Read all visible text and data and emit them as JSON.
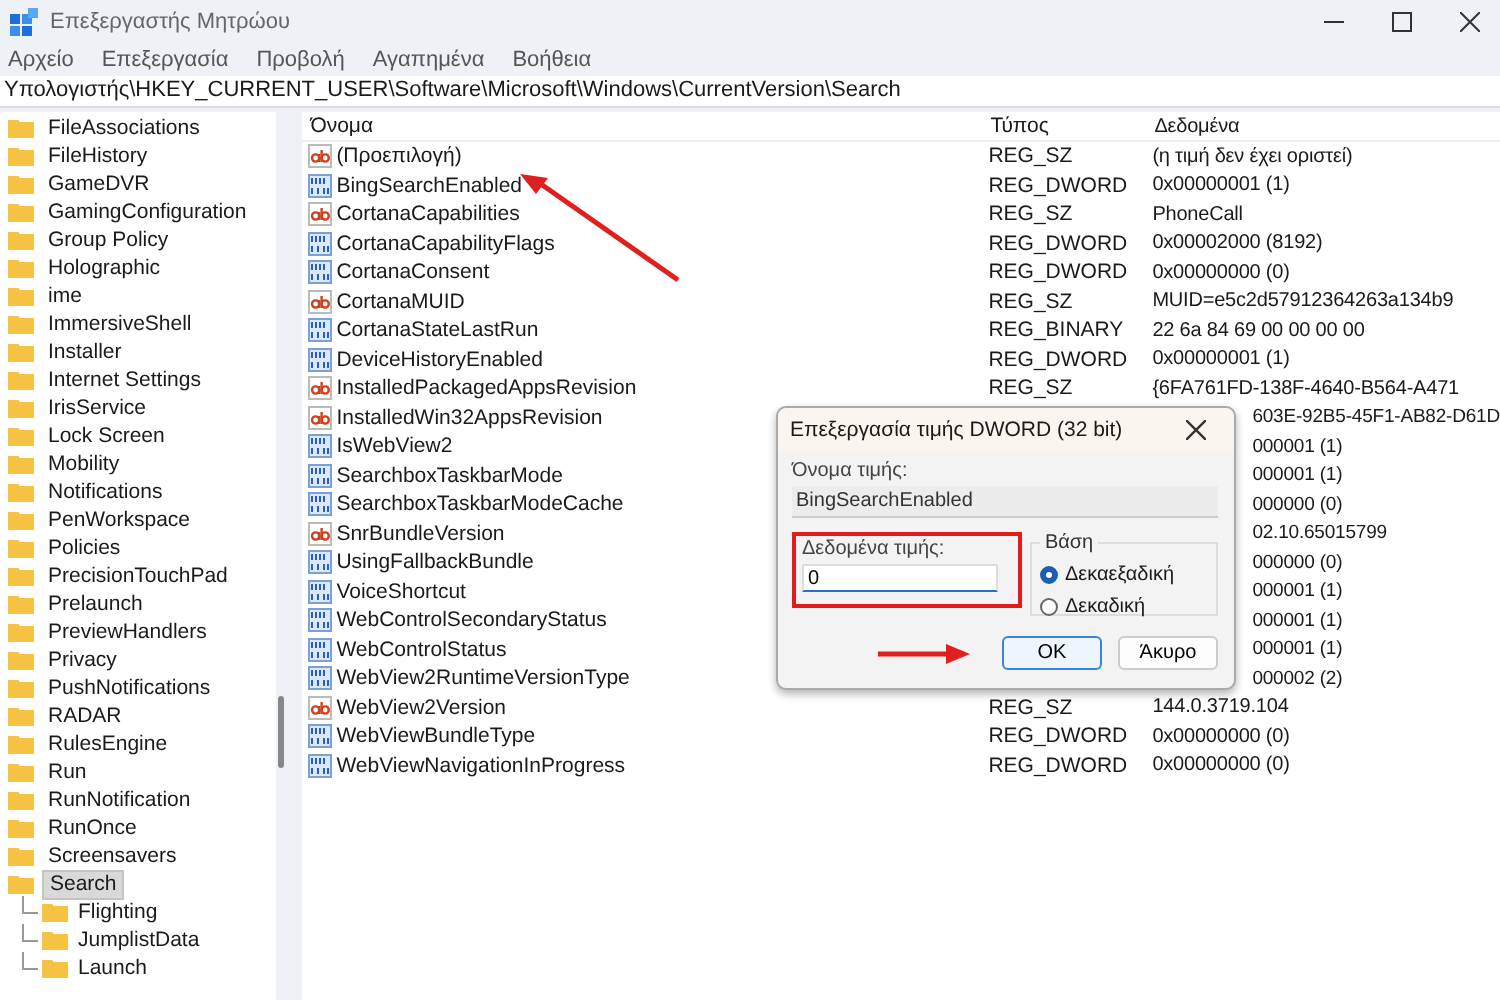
{
  "window": {
    "title": "Επεξεργαστής Μητρώου"
  },
  "menu": [
    "Αρχείο",
    "Επεξεργασία",
    "Προβολή",
    "Αγαπημένα",
    "Βοήθεια"
  ],
  "address": "Υπολογιστής\\HKEY_CURRENT_USER\\Software\\Microsoft\\Windows\\CurrentVersion\\Search",
  "tree": [
    {
      "label": "FileAssociations",
      "selected": false
    },
    {
      "label": "FileHistory",
      "selected": false
    },
    {
      "label": "GameDVR",
      "selected": false
    },
    {
      "label": "GamingConfiguration",
      "selected": false
    },
    {
      "label": "Group Policy",
      "selected": false
    },
    {
      "label": "Holographic",
      "selected": false
    },
    {
      "label": "ime",
      "selected": false
    },
    {
      "label": "ImmersiveShell",
      "selected": false
    },
    {
      "label": "Installer",
      "selected": false
    },
    {
      "label": "Internet Settings",
      "selected": false
    },
    {
      "label": "IrisService",
      "selected": false
    },
    {
      "label": "Lock Screen",
      "selected": false
    },
    {
      "label": "Mobility",
      "selected": false
    },
    {
      "label": "Notifications",
      "selected": false
    },
    {
      "label": "PenWorkspace",
      "selected": false
    },
    {
      "label": "Policies",
      "selected": false
    },
    {
      "label": "PrecisionTouchPad",
      "selected": false
    },
    {
      "label": "Prelaunch",
      "selected": false
    },
    {
      "label": "PreviewHandlers",
      "selected": false
    },
    {
      "label": "Privacy",
      "selected": false
    },
    {
      "label": "PushNotifications",
      "selected": false
    },
    {
      "label": "RADAR",
      "selected": false
    },
    {
      "label": "RulesEngine",
      "selected": false
    },
    {
      "label": "Run",
      "selected": false
    },
    {
      "label": "RunNotification",
      "selected": false
    },
    {
      "label": "RunOnce",
      "selected": false
    },
    {
      "label": "Screensavers",
      "selected": false
    },
    {
      "label": "Search",
      "selected": true,
      "children": [
        {
          "label": "Flighting",
          "selected": false
        },
        {
          "label": "JumplistData",
          "selected": false
        },
        {
          "label": "Launch",
          "selected": false
        }
      ]
    }
  ],
  "table": {
    "columns": [
      "Όνομα",
      "Τύπος",
      "Δεδομένα"
    ],
    "rows": [
      {
        "kind": "string",
        "name": "(Προεπιλογή)",
        "type": "REG_SZ",
        "data": "(η τιμή δεν έχει οριστεί)"
      },
      {
        "kind": "binary",
        "name": "BingSearchEnabled",
        "type": "REG_DWORD",
        "data": "0x00000001 (1)"
      },
      {
        "kind": "string",
        "name": "CortanaCapabilities",
        "type": "REG_SZ",
        "data": "PhoneCall"
      },
      {
        "kind": "binary",
        "name": "CortanaCapabilityFlags",
        "type": "REG_DWORD",
        "data": "0x00002000 (8192)"
      },
      {
        "kind": "binary",
        "name": "CortanaConsent",
        "type": "REG_DWORD",
        "data": "0x00000000 (0)"
      },
      {
        "kind": "string",
        "name": "CortanaMUID",
        "type": "REG_SZ",
        "data": "MUID=e5c2d57912364263a134b9"
      },
      {
        "kind": "binary",
        "name": "CortanaStateLastRun",
        "type": "REG_BINARY",
        "data": "22 6a 84 69 00 00 00 00"
      },
      {
        "kind": "binary",
        "name": "DeviceHistoryEnabled",
        "type": "REG_DWORD",
        "data": "0x00000001 (1)"
      },
      {
        "kind": "string",
        "name": "InstalledPackagedAppsRevision",
        "type": "REG_SZ",
        "data": "{6FA761FD-138F-4640-B564-A471"
      },
      {
        "kind": "string",
        "name": "InstalledWin32AppsRevision",
        "data": "603E-92B5-45F1-AB82-D61D"
      },
      {
        "kind": "binary",
        "name": "IsWebView2",
        "data": "000001 (1)"
      },
      {
        "kind": "binary",
        "name": "SearchboxTaskbarMode",
        "data": "000001 (1)"
      },
      {
        "kind": "binary",
        "name": "SearchboxTaskbarModeCache",
        "data": "000000 (0)"
      },
      {
        "kind": "string",
        "name": "SnrBundleVersion",
        "data": "02.10.65015799"
      },
      {
        "kind": "binary",
        "name": "UsingFallbackBundle",
        "data": "000000 (0)"
      },
      {
        "kind": "binary",
        "name": "VoiceShortcut",
        "data": "000001 (1)"
      },
      {
        "kind": "binary",
        "name": "WebControlSecondaryStatus",
        "data": "000001 (1)"
      },
      {
        "kind": "binary",
        "name": "WebControlStatus",
        "data": "000001 (1)"
      },
      {
        "kind": "binary",
        "name": "WebView2RuntimeVersionType",
        "data": "000002 (2)"
      },
      {
        "kind": "string",
        "name": "WebView2Version",
        "type": "REG_SZ",
        "data": "144.0.3719.104"
      },
      {
        "kind": "binary",
        "name": "WebViewBundleType",
        "type": "REG_DWORD",
        "data": "0x00000000 (0)"
      },
      {
        "kind": "binary",
        "name": "WebViewNavigationInProgress",
        "type": "REG_DWORD",
        "data": "0x00000000 (0)"
      }
    ]
  },
  "dialog": {
    "title": "Επεξεργασία τιμής DWORD (32 bit)",
    "name_label": "Όνομα τιμής:",
    "name_value": "BingSearchEnabled",
    "data_label": "Δεδομένα τιμής:",
    "data_value": "0",
    "base_label": "Βάση",
    "bases": [
      {
        "label": "Δεκαεξαδική",
        "selected": true
      },
      {
        "label": "Δεκαδική",
        "selected": false
      }
    ],
    "buttons": [
      {
        "label": "OK",
        "selected": true
      },
      {
        "label": "Άκυρο",
        "selected": false
      }
    ]
  }
}
